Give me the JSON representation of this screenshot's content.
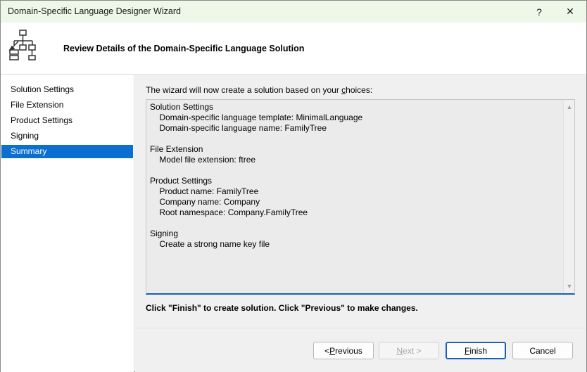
{
  "window": {
    "title": "Domain-Specific Language Designer Wizard",
    "help_label": "?",
    "close_label": "✕"
  },
  "header": {
    "title": "Review Details of the Domain-Specific Language Solution",
    "icon": "hierarchy-diagram-icon"
  },
  "nav": {
    "items": [
      {
        "label": "Solution Settings"
      },
      {
        "label": "File Extension"
      },
      {
        "label": "Product Settings"
      },
      {
        "label": "Signing"
      },
      {
        "label": "Summary"
      }
    ],
    "selected": "Summary",
    "selected_color": "#0a6fd1"
  },
  "content": {
    "intro_pre": "The wizard will now create a solution based on your ",
    "intro_accel": "c",
    "intro_post": "hoices:",
    "summary_text": "Solution Settings\n    Domain-specific language template: MinimalLanguage\n    Domain-specific language name: FamilyTree\n\nFile Extension\n    Model file extension: ftree\n\nProduct Settings\n    Product name: FamilyTree\n    Company name: Company\n    Root namespace: Company.FamilyTree\n\nSigning\n    Create a strong name key file",
    "hint": "Click \"Finish\" to create solution. Click \"Previous\" to make changes."
  },
  "buttons": {
    "previous": {
      "pre": "< ",
      "accel": "P",
      "post": "revious"
    },
    "next": {
      "pre": "",
      "accel": "N",
      "post": "ext >"
    },
    "finish": {
      "pre": "",
      "accel": "F",
      "post": "inish"
    },
    "cancel": "Cancel"
  },
  "colors": {
    "titlebar_bg": "#eef8e8",
    "accent": "#1a5fb4"
  }
}
